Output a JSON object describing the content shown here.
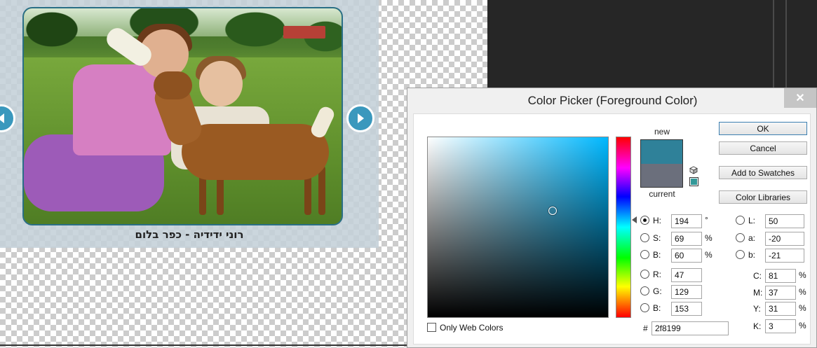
{
  "slideshow": {
    "caption": "רוני ידידיה - כפר בלום"
  },
  "color_picker": {
    "title": "Color Picker (Foreground Color)",
    "close_label": "✕",
    "new_label": "new",
    "current_label": "current",
    "new_color": "#2f8199",
    "current_color": "#6b6f7c",
    "websafe_color": "#339999",
    "buttons": {
      "ok": "OK",
      "cancel": "Cancel",
      "add_to_swatches": "Add to Swatches",
      "color_libraries": "Color Libraries"
    },
    "hsb": {
      "h_label": "H:",
      "h_value": "194",
      "h_unit": "°",
      "s_label": "S:",
      "s_value": "69",
      "s_unit": "%",
      "b_label": "B:",
      "b_value": "60",
      "b_unit": "%"
    },
    "rgb": {
      "r_label": "R:",
      "r_value": "47",
      "g_label": "G:",
      "g_value": "129",
      "b_label": "B:",
      "b_value": "153"
    },
    "lab": {
      "l_label": "L:",
      "l_value": "50",
      "a_label": "a:",
      "a_value": "-20",
      "b_label": "b:",
      "b_value": "-21"
    },
    "cmyk": {
      "c_label": "C:",
      "c_value": "81",
      "c_unit": "%",
      "m_label": "M:",
      "m_value": "37",
      "m_unit": "%",
      "y_label": "Y:",
      "y_value": "31",
      "y_unit": "%",
      "k_label": "K:",
      "k_value": "3",
      "k_unit": "%"
    },
    "hex_label": "#",
    "hex_value": "2f8199",
    "only_web_colors_label": "Only Web Colors",
    "only_web_colors_checked": false
  }
}
